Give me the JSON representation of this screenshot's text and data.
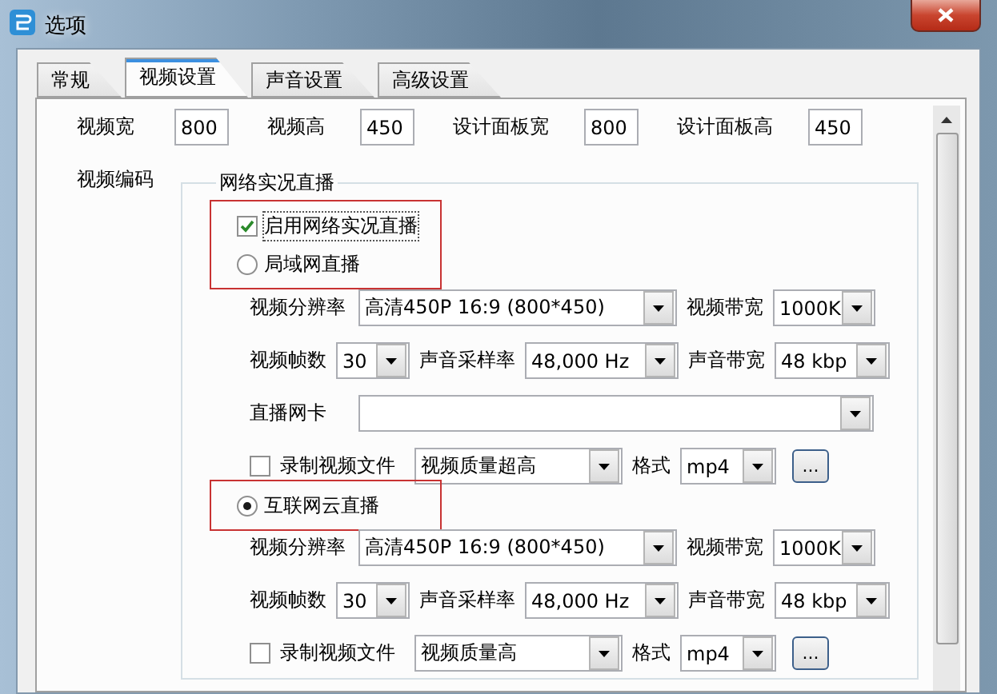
{
  "window": {
    "title": "选项"
  },
  "tabs": [
    {
      "label": "常规",
      "selected": false
    },
    {
      "label": "视频设置",
      "selected": true
    },
    {
      "label": "声音设置",
      "selected": false
    },
    {
      "label": "高级设置",
      "selected": false
    }
  ],
  "size_fields": [
    {
      "label": "视频宽",
      "value": "800"
    },
    {
      "label": "视频高",
      "value": "450"
    },
    {
      "label": "设计面板宽",
      "value": "800"
    },
    {
      "label": "设计面板高",
      "value": "450"
    }
  ],
  "encoding_label": "视频编码",
  "live_group": {
    "legend": "网络实况直播",
    "enable": {
      "label": "启用网络实况直播",
      "checked": true
    },
    "modes": [
      {
        "label": "局域网直播",
        "selected": false,
        "highlighted": true,
        "settings": {
          "resolution_label": "视频分辨率",
          "resolution": "高清450P 16:9 (800*450)",
          "video_bitrate_label": "视频带宽",
          "video_bitrate": "1000K",
          "fps_label": "视频帧数",
          "fps": "30",
          "sample_rate_label": "声音采样率",
          "sample_rate": "48,000 Hz",
          "audio_bitrate_label": "声音带宽",
          "audio_bitrate": "48 kbp",
          "nic_label": "直播网卡",
          "record": {
            "label": "录制视频文件",
            "checked": false,
            "quality": "视频质量超高"
          },
          "format_label": "格式",
          "format": "mp4",
          "browse": "..."
        }
      },
      {
        "label": "互联网云直播",
        "selected": true,
        "highlighted": true,
        "settings": {
          "resolution_label": "视频分辨率",
          "resolution": "高清450P 16:9 (800*450)",
          "video_bitrate_label": "视频带宽",
          "video_bitrate": "1000K",
          "fps_label": "视频帧数",
          "fps": "30",
          "sample_rate_label": "声音采样率",
          "sample_rate": "48,000 Hz",
          "audio_bitrate_label": "声音带宽",
          "audio_bitrate": "48 kbp",
          "record": {
            "label": "录制视频文件",
            "checked": false,
            "quality": "视频质量高"
          },
          "format_label": "格式",
          "format": "mp4",
          "browse": "..."
        }
      }
    ]
  }
}
